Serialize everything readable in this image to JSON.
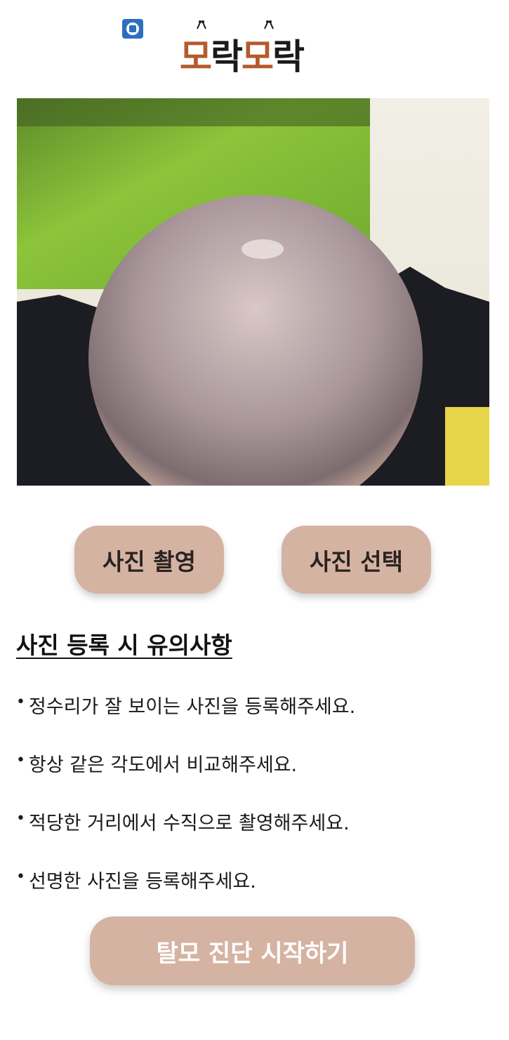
{
  "app": {
    "logo_part1": "모",
    "logo_part2": "락",
    "logo_part3": "모",
    "logo_part4": "락",
    "brand_color": "#b55a2c"
  },
  "photo": {
    "icon": "scalp-photo-image"
  },
  "actions": {
    "camera_label": "사진 촬영",
    "select_label": "사진 선택",
    "button_color": "#d5b3a2"
  },
  "notes": {
    "title": "사진 등록 시 유의사항",
    "items": [
      "정수리가 잘 보이는 사진을 등록해주세요.",
      "항상 같은 각도에서 비교해주세요.",
      "적당한 거리에서 수직으로 촬영해주세요.",
      "선명한 사진을 등록해주세요."
    ]
  },
  "start": {
    "label": "탈모 진단 시작하기"
  }
}
